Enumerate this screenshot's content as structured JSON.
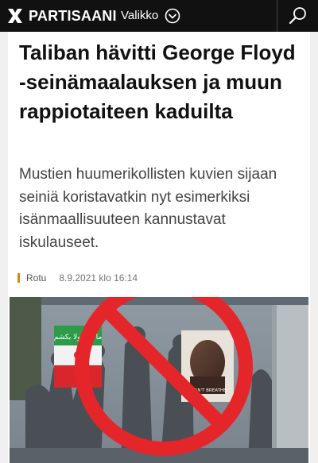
{
  "header": {
    "logo_text": "PARTISAANI",
    "menu_label": "Valikko",
    "icons": {
      "logo": "x-logo-icon",
      "menu": "chevron-down-circle-icon",
      "search": "search-icon"
    }
  },
  "article": {
    "headline": "Taliban hävitti George Floyd -seinämaalauksen ja muun rappiotaiteen kaduilta",
    "lead": "Mustien huumerikollisten kuvien sijaan seiniä koristavatkin nyt esimerkiksi isänmaallisuuteen kannustavat iskulauseet.",
    "category": "Rotu",
    "date": "8.9.2021 klo 16:14",
    "image": {
      "mural_banner": "ما تیر لولا بکشم",
      "mural_caption": "I CAN'T BREATHE",
      "overlay": "prohibition-sign"
    }
  },
  "colors": {
    "topbar": "#111111",
    "accent": "#d9831c",
    "prohibit": "#e4262b"
  }
}
